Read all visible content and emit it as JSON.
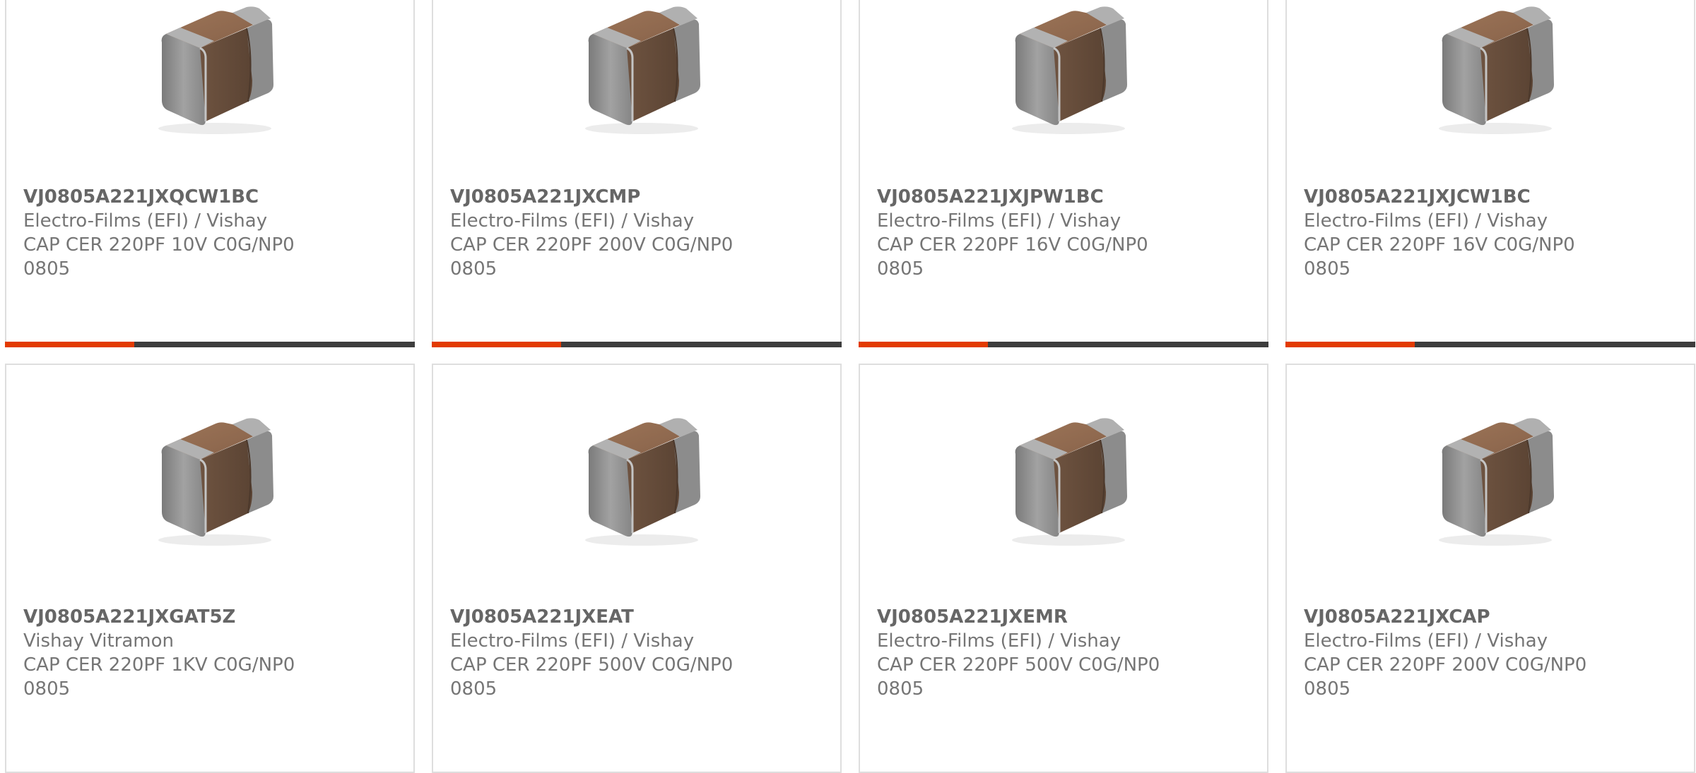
{
  "colors": {
    "accent": "#e23b00",
    "bar_dark": "#3d3d3d",
    "card_border": "#dedede",
    "part_number_text": "#666666",
    "body_text": "#757575"
  },
  "products": [
    {
      "part_number": "VJ0805A221JXQCW1BC",
      "manufacturer": "Electro-Films (EFI) / Vishay",
      "description": "CAP CER 220PF 10V C0G/NP0",
      "package": "0805",
      "image_icon": "smd-ceramic-capacitor-icon"
    },
    {
      "part_number": "VJ0805A221JXCMP",
      "manufacturer": "Electro-Films (EFI) / Vishay",
      "description": "CAP CER 220PF 200V C0G/NP0",
      "package": "0805",
      "image_icon": "smd-ceramic-capacitor-icon"
    },
    {
      "part_number": "VJ0805A221JXJPW1BC",
      "manufacturer": "Electro-Films (EFI) / Vishay",
      "description": "CAP CER 220PF 16V C0G/NP0",
      "package": "0805",
      "image_icon": "smd-ceramic-capacitor-icon"
    },
    {
      "part_number": "VJ0805A221JXJCW1BC",
      "manufacturer": "Electro-Films (EFI) / Vishay",
      "description": "CAP CER 220PF 16V C0G/NP0",
      "package": "0805",
      "image_icon": "smd-ceramic-capacitor-icon"
    },
    {
      "part_number": "VJ0805A221JXGAT5Z",
      "manufacturer": "Vishay Vitramon",
      "description": "CAP CER 220PF 1KV C0G/NP0",
      "package": "0805",
      "image_icon": "smd-ceramic-capacitor-icon"
    },
    {
      "part_number": "VJ0805A221JXEAT",
      "manufacturer": "Electro-Films (EFI) / Vishay",
      "description": "CAP CER 220PF 500V C0G/NP0",
      "package": "0805",
      "image_icon": "smd-ceramic-capacitor-icon"
    },
    {
      "part_number": "VJ0805A221JXEMR",
      "manufacturer": "Electro-Films (EFI) / Vishay",
      "description": "CAP CER 220PF 500V C0G/NP0",
      "package": "0805",
      "image_icon": "smd-ceramic-capacitor-icon"
    },
    {
      "part_number": "VJ0805A221JXCAP",
      "manufacturer": "Electro-Films (EFI) / Vishay",
      "description": "CAP CER 220PF 200V C0G/NP0",
      "package": "0805",
      "image_icon": "smd-ceramic-capacitor-icon"
    }
  ]
}
